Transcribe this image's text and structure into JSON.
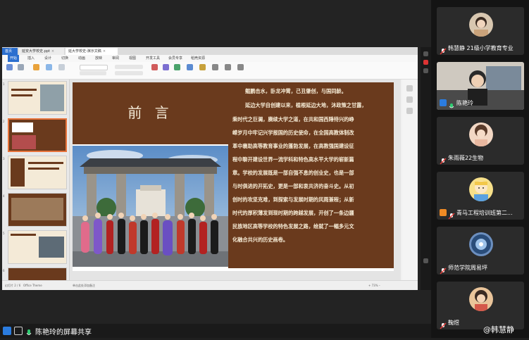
{
  "wps": {
    "tabs": [
      {
        "label": "首页"
      },
      {
        "label": "延安大学校史.ppt"
      },
      {
        "label": "延大学校史-演示文稿"
      }
    ],
    "menu": [
      "开始",
      "插入",
      "设计",
      "切换",
      "动画",
      "放映",
      "审阅",
      "视图",
      "开发工具",
      "会员专享",
      "稻壳资源"
    ],
    "slide_numbers": [
      "1",
      "2",
      "3",
      "4",
      "5",
      "6"
    ],
    "slide": {
      "title": "前 言",
      "body_lines": [
        "鲲鹏击水，卧龙冲霄，己丑肇创，与国同龄。",
        "延边大学自创建以来，植根延边大地，沐政策之甘露，",
        "乘时代之巨澜，赓续大学之道，在共和国西陲待兴的峥",
        "嵘岁月中牢记兴学报国的历史使命，在全国高教体制改",
        "革中襄助高等教育事业的蓬勃发展，在高教强国建设征",
        "程中聊开建设世界一流学科和特色高水平大学的崭新篇",
        "章。学校的发展既是一部自强不息的创业史，也是一部",
        "与时俱进的开拓史，更是一部和衷共济的奋斗史。从初",
        "创时的攻坚克难，到探索与发展时期的风雨兼程；从新",
        "时代的厚积薄发到现时期的跨越发展，开创了一条边疆",
        "民族地区高等学校的特色发展之路，绘就了一幅多元文",
        "化融合共兴的历史画卷。"
      ]
    },
    "status": {
      "slide_info": "幻灯片 2 / 6",
      "theme": "Office Theme",
      "notes": "单击此处添加备注",
      "zoom": "+ 73% –"
    }
  },
  "participants": [
    {
      "name": "韩慧静 21级小学教育专业",
      "muted": true
    },
    {
      "name": "陈艳玲",
      "muted": false,
      "host": true
    },
    {
      "name": "朱雨薇22生物",
      "muted": true
    },
    {
      "name": "青马工程培训班第二...",
      "muted": true,
      "host": true
    },
    {
      "name": "师范学院周易坪",
      "muted": true
    },
    {
      "name": "鞠煜",
      "muted": true
    }
  ],
  "share_bar": {
    "label": "陈艳玲的屏幕共享"
  },
  "watermark": "@韩慧静",
  "colors": {
    "slide_brown": "#6a3a1d",
    "accent_blue": "#2b6fcf",
    "mute_red": "#e53935",
    "speak_green": "#2ecc71"
  }
}
